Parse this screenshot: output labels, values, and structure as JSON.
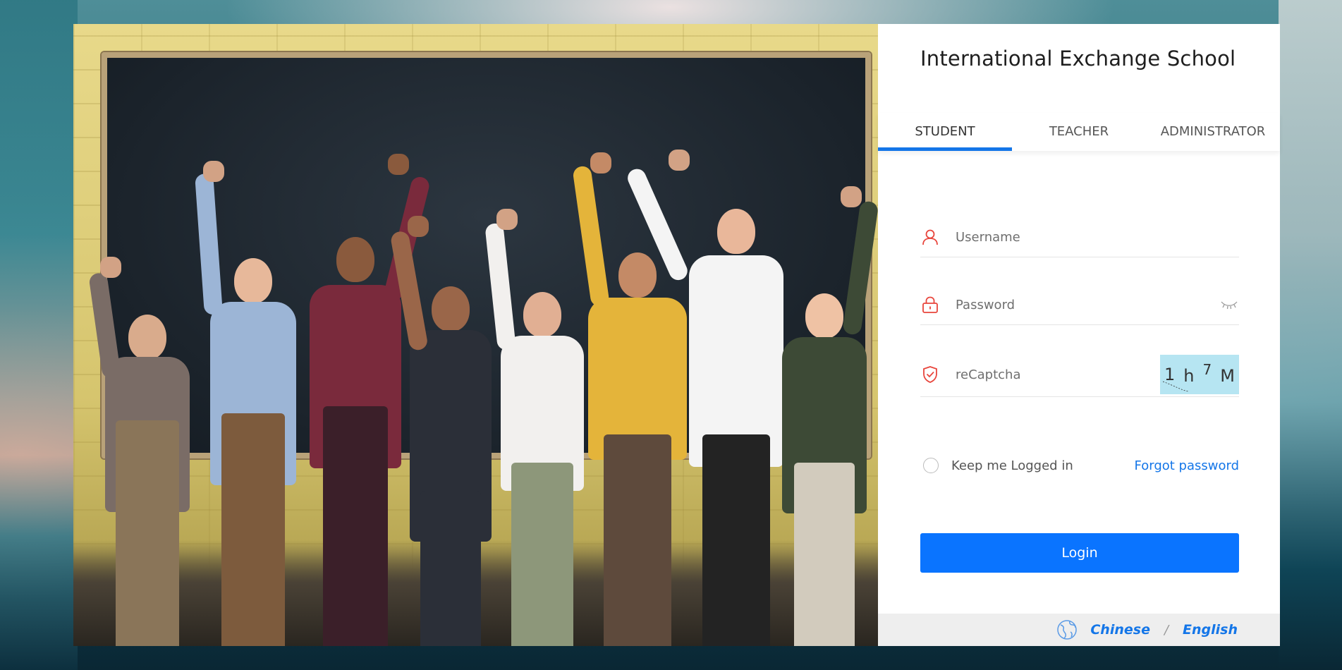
{
  "school": {
    "title": "International Exchange School"
  },
  "photo": {
    "subject": "group-of-students-celebrating"
  },
  "tabs": [
    {
      "label": "STUDENT",
      "active": true
    },
    {
      "label": "TEACHER",
      "active": false
    },
    {
      "label": "ADMINISTRATOR",
      "active": false
    }
  ],
  "form": {
    "username": {
      "placeholder": "Username",
      "value": "",
      "icon": "user-icon"
    },
    "password": {
      "placeholder": "Password",
      "value": "",
      "icon": "lock-icon",
      "toggle_icon": "eye-closed-icon"
    },
    "captcha": {
      "placeholder": "reCaptcha",
      "value": "",
      "icon": "shield-check-icon",
      "code_chars": [
        "1",
        "h",
        "7",
        "M"
      ]
    },
    "remember_label": "Keep me Logged in",
    "remember_checked": false,
    "forgot_label": "Forgot password",
    "login_label": "Login"
  },
  "language": {
    "icon": "globe-icon",
    "options": [
      "Chinese",
      "English"
    ],
    "separator": "/"
  },
  "colors": {
    "accent": "#1476e8",
    "button": "#0a74ff",
    "icon_red": "#e8453c",
    "captcha_bg": "#b6e5f2",
    "lang_bar_bg": "#eeeeee"
  }
}
